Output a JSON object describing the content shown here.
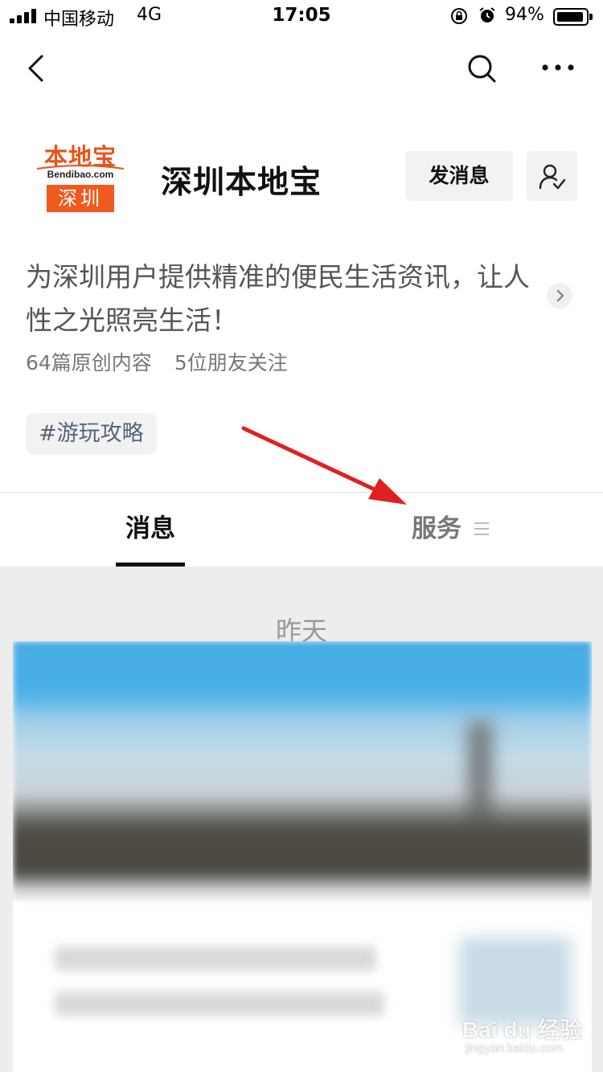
{
  "status_bar": {
    "carrier": "中国移动",
    "network": "4G",
    "time": "17:05",
    "battery_percent": "94%",
    "battery_level": 0.94,
    "icons": [
      "signal-icon",
      "orientation-lock-icon",
      "alarm-icon",
      "battery-icon"
    ]
  },
  "nav": {
    "back_icon": "chevron-left-icon",
    "search_icon": "search-icon",
    "more_icon": "more-dots-icon"
  },
  "profile": {
    "logo_text": "本地宝",
    "logo_domain": "Bendibao.com",
    "logo_city": "深圳",
    "name": "深圳本地宝",
    "send_message_label": "发消息",
    "follow_icon": "user-check-icon",
    "description": "为深圳用户提供精准的便民生活资讯，让人性之光照亮生活！",
    "original_count": "64篇原创内容",
    "friends_following": "5位朋友关注",
    "tag": "#游玩攻略"
  },
  "tabs": {
    "messages": "消息",
    "services": "服务",
    "services_icon": "menu-lines-icon",
    "active": "messages"
  },
  "feed": {
    "date_label": "昨天"
  },
  "watermark": {
    "main": "Bai du 经验",
    "sub": "jingyan.baidu.com"
  },
  "colors": {
    "brand_orange": "#ef5a1e",
    "annotation_arrow": "#e02020",
    "tag_text": "#56647c"
  }
}
